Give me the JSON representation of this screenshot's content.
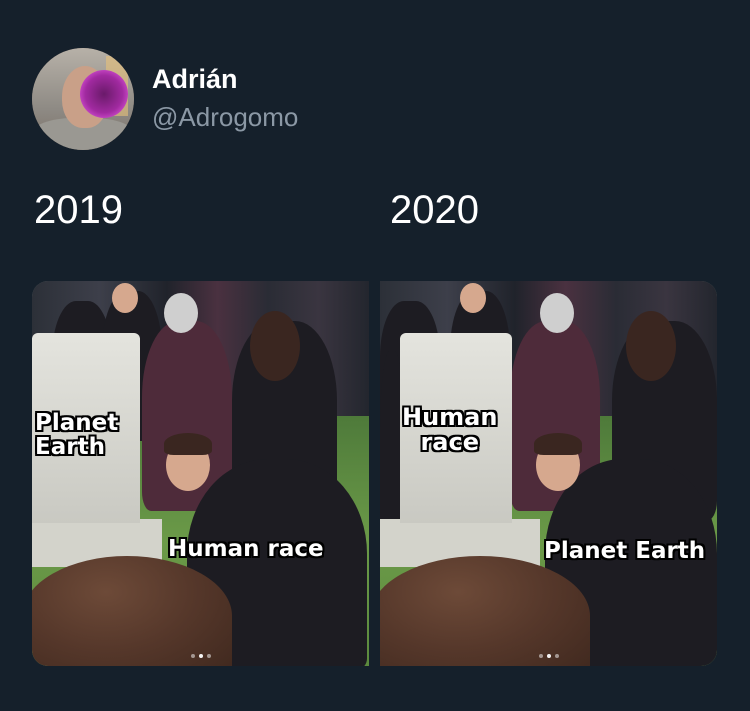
{
  "tweet": {
    "author_name": "Adrián",
    "author_handle": "@Adrogomo",
    "panels": [
      {
        "year": "2019",
        "tombstone_caption": "Planet Earth",
        "tombstone_caption_lines": [
          "Planet",
          "Earth"
        ],
        "person_caption": "Human race"
      },
      {
        "year": "2020",
        "tombstone_caption": "Human race",
        "tombstone_caption_lines": [
          "Human",
          "race"
        ],
        "person_caption": "Planet Earth"
      }
    ]
  },
  "colors": {
    "background": "#15202b",
    "handle": "#8b98a5",
    "text": "#ffffff"
  },
  "icons": {
    "avatar": "profile-avatar-image"
  }
}
